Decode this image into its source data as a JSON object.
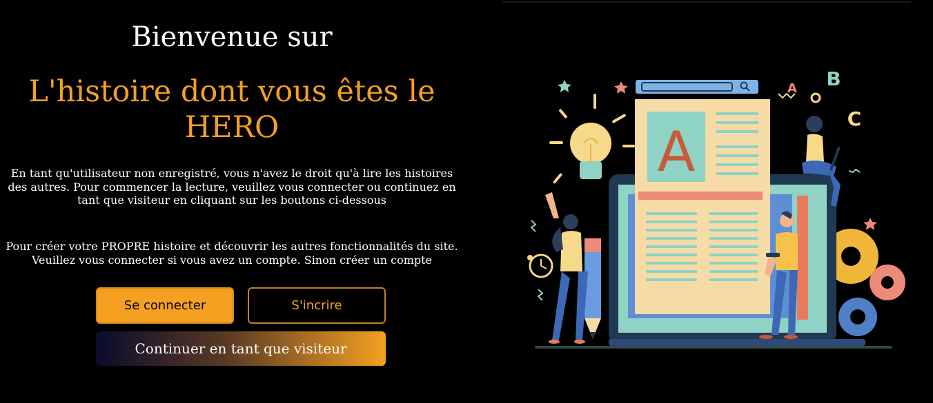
{
  "hero": {
    "welcome": "Bienvenue sur",
    "title": "L'histoire dont vous êtes le HERO",
    "intro": "En tant qu'utilisateur non enregistré, vous n'avez le droit qu'à lire les histoires des autres. Pour commencer la lecture, veuillez vous connecter ou continuez en tant que visiteur en cliquant sur les boutons ci-dessous",
    "cta": "Pour créer votre PROPRE histoire et découvrir les autres fonctionnalités du site. Veuillez vous connecter si vous avez un compte. Sinon créer un compte"
  },
  "buttons": {
    "login": "Se connecter",
    "signup": "S'incrire",
    "visitor": "Continuer en tant que visiteur"
  },
  "illustration": {
    "letters": [
      "A",
      "B",
      "C"
    ],
    "icons": [
      "lightbulb-icon",
      "search-icon",
      "gear-icon",
      "clock-icon",
      "pencil-icon",
      "star-icon"
    ]
  },
  "colors": {
    "accent": "#f5a021",
    "background": "#000000",
    "illustration_navy": "#1f3a52",
    "illustration_cream": "#f7dba6",
    "illustration_teal": "#8fd3c4",
    "illustration_coral": "#e87a5d"
  }
}
